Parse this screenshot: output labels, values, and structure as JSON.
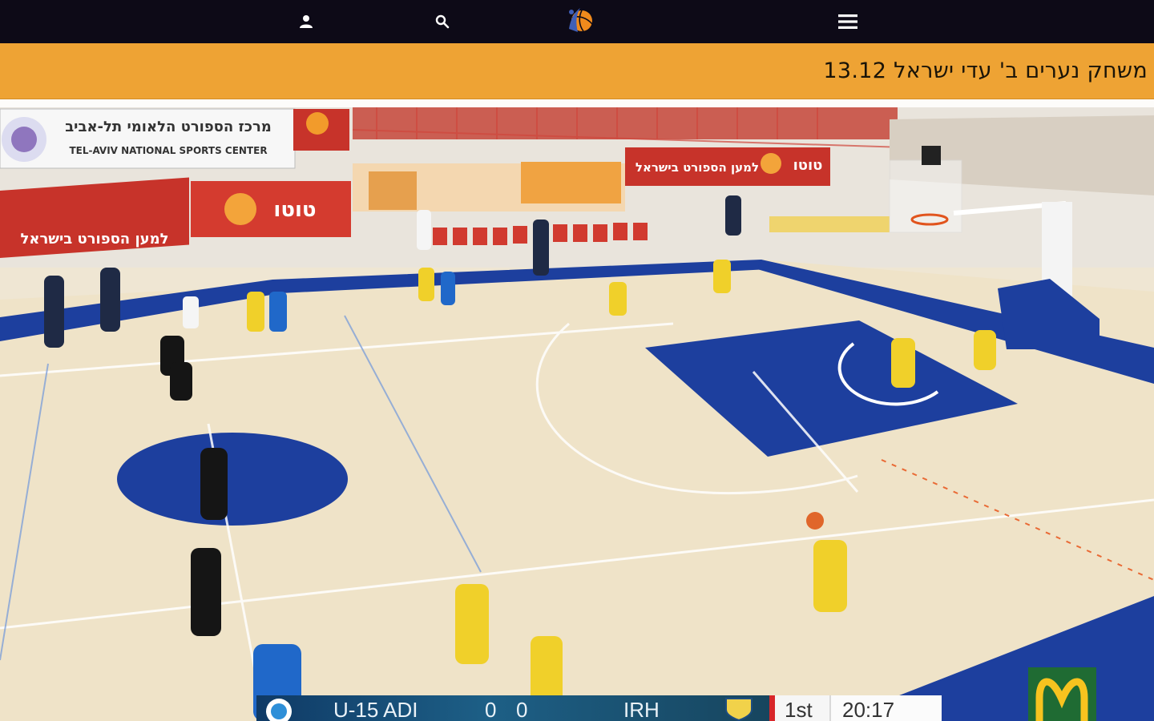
{
  "topbar": {
    "icons": [
      "user-icon",
      "search-icon",
      "basketball-logo",
      "hamburger-menu-icon"
    ]
  },
  "banner": {
    "title": "משחק נערים ב' עדי ישראל 13.12"
  },
  "video": {
    "signage": {
      "sports_center_he": "מרכז הספורט הלאומי תל-אביב",
      "sports_center_en": "TEL-AVIV NATIONAL SPORTS CENTER",
      "toto_brand": "טוטו",
      "toto_slogan": "למען הספורט בישראל"
    },
    "scoreboard": {
      "home_team": "U-15 ADI",
      "home_score": "0",
      "away_score": "0",
      "away_team": "IRH",
      "period": "1st",
      "clock": "20:17"
    },
    "colors": {
      "court_blue": "#1d3f9e",
      "floor": "#efe3c8",
      "banner_orange": "#eea334",
      "toto_red": "#c7332a",
      "mcdonalds_green": "#1f6b33",
      "mcdonalds_yellow": "#f7c31f"
    }
  }
}
